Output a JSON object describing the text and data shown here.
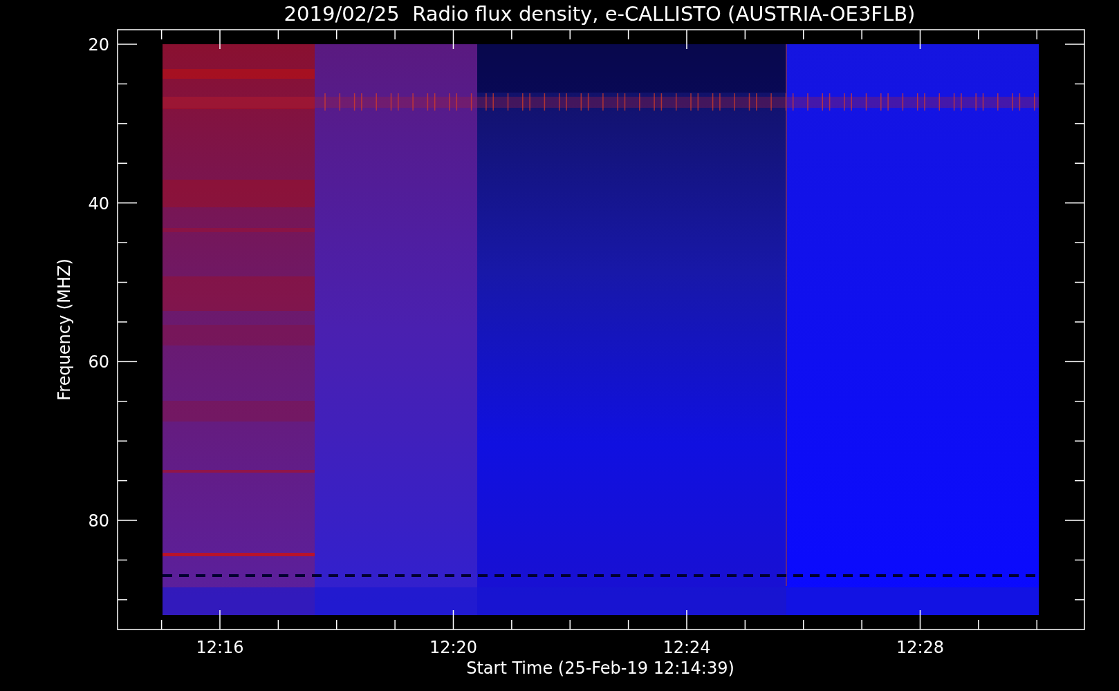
{
  "chart": {
    "title": "2019/02/25  Radio flux density, e-CALLISTO (AUSTRIA-OE3FLB)",
    "ylabel": "Frequency (MHZ)",
    "xlabel": "Start Time (25-Feb-19 12:14:39)",
    "yticks": [
      "20",
      "40",
      "60",
      "80"
    ],
    "xticks": [
      "12:16",
      "12:20",
      "12:24",
      "12:28"
    ]
  }
}
